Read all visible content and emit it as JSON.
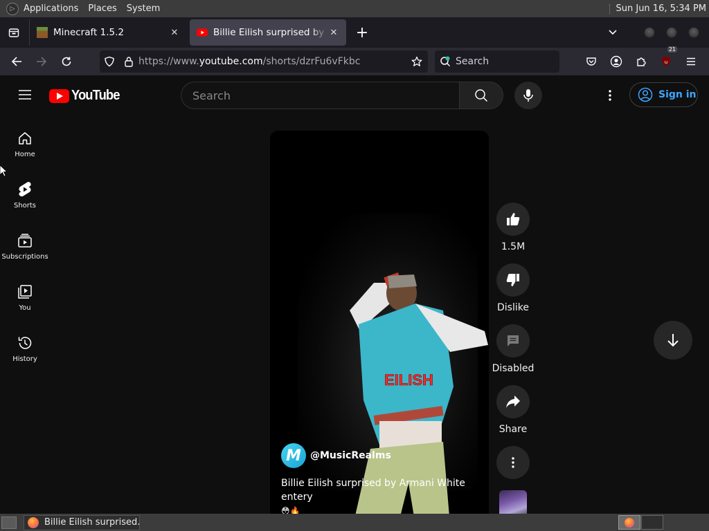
{
  "gnome_panel": {
    "menus": [
      "Applications",
      "Places",
      "System"
    ],
    "clock": "Sun Jun 16,  5:34 PM"
  },
  "browser": {
    "tabs": [
      {
        "title": "Minecraft 1.5.2",
        "active": false
      },
      {
        "title": "Billie Eilish surprised by Armani White entery",
        "active": true
      }
    ],
    "url": {
      "prefix": "https://www.",
      "host": "youtube.com",
      "path": "/shorts/dzrFu6vFkbc"
    },
    "search_placeholder": "Search",
    "extension_badge": "21"
  },
  "youtube": {
    "logo_text": "YouTube",
    "search_placeholder": "Search",
    "sign_in_label": "Sign in",
    "sidebar": [
      {
        "label": "Home",
        "icon": "home-icon"
      },
      {
        "label": "Shorts",
        "icon": "shorts-icon"
      },
      {
        "label": "Subscriptions",
        "icon": "subscriptions-icon"
      },
      {
        "label": "You",
        "icon": "you-icon"
      },
      {
        "label": "History",
        "icon": "history-icon"
      }
    ],
    "short": {
      "overlay_text": "EILISH",
      "channel_initial": "M",
      "channel": "@MusicRealms",
      "title": "Billie Eilish surprised by Armani White entery",
      "title_emoji": "😳🔥"
    },
    "actions": {
      "like_count": "1.5M",
      "dislike_label": "Dislike",
      "comments_label": "Disabled",
      "share_label": "Share"
    }
  },
  "taskbar": {
    "window_title": "Billie Eilish surprised..."
  }
}
